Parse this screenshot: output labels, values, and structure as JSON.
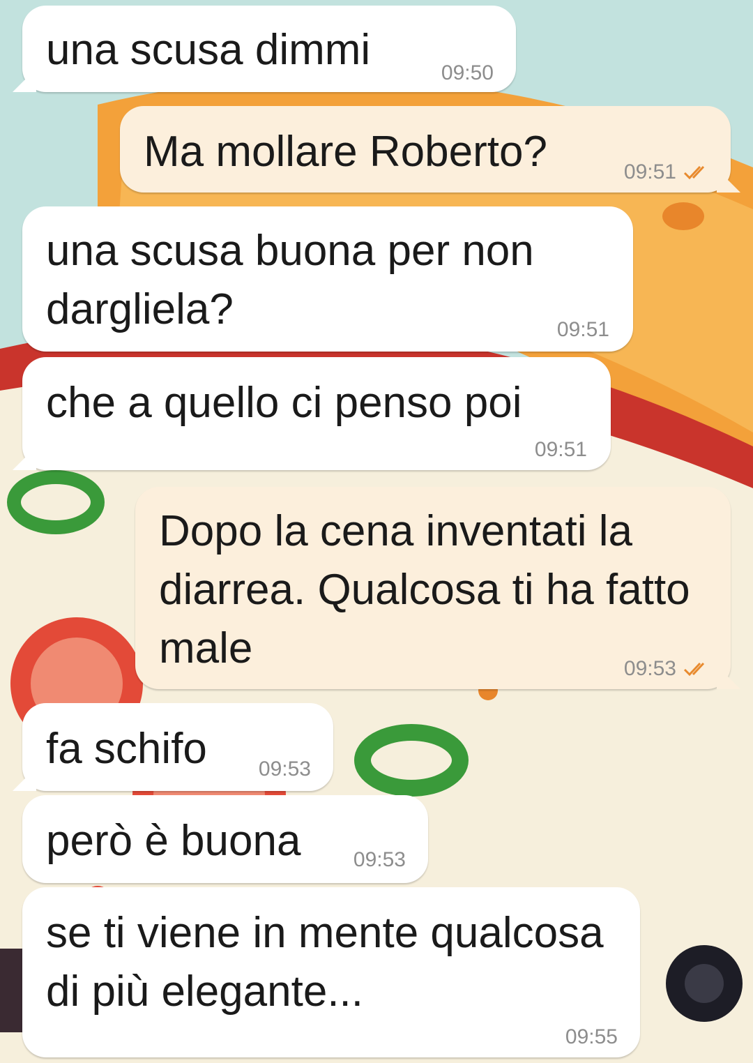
{
  "theme": {
    "incoming_bg": "#ffffff",
    "outgoing_bg": "#fcefdc",
    "check_color": "#e88a2e",
    "time_color": "#8d8d8d"
  },
  "messages": [
    {
      "direction": "in",
      "text": "una scusa dimmi",
      "time": "09:50"
    },
    {
      "direction": "out",
      "text": "Ma mollare Roberto?",
      "time": "09:51",
      "status_icon": "double-check-icon"
    },
    {
      "direction": "in",
      "text": "una scusa buona per non dargliela?",
      "time": "09:51"
    },
    {
      "direction": "in",
      "text": "che a quello ci penso poi",
      "time": "09:51"
    },
    {
      "direction": "out",
      "text": "Dopo la cena inventati la diarrea. Qualcosa ti ha fatto male",
      "time": "09:53",
      "status_icon": "double-check-icon"
    },
    {
      "direction": "in",
      "text": "fa schifo",
      "time": "09:53"
    },
    {
      "direction": "in",
      "text": "però è buona",
      "time": "09:53"
    },
    {
      "direction": "in",
      "text": "se ti viene in mente qualcosa di più elegante...",
      "time": "09:55"
    }
  ]
}
